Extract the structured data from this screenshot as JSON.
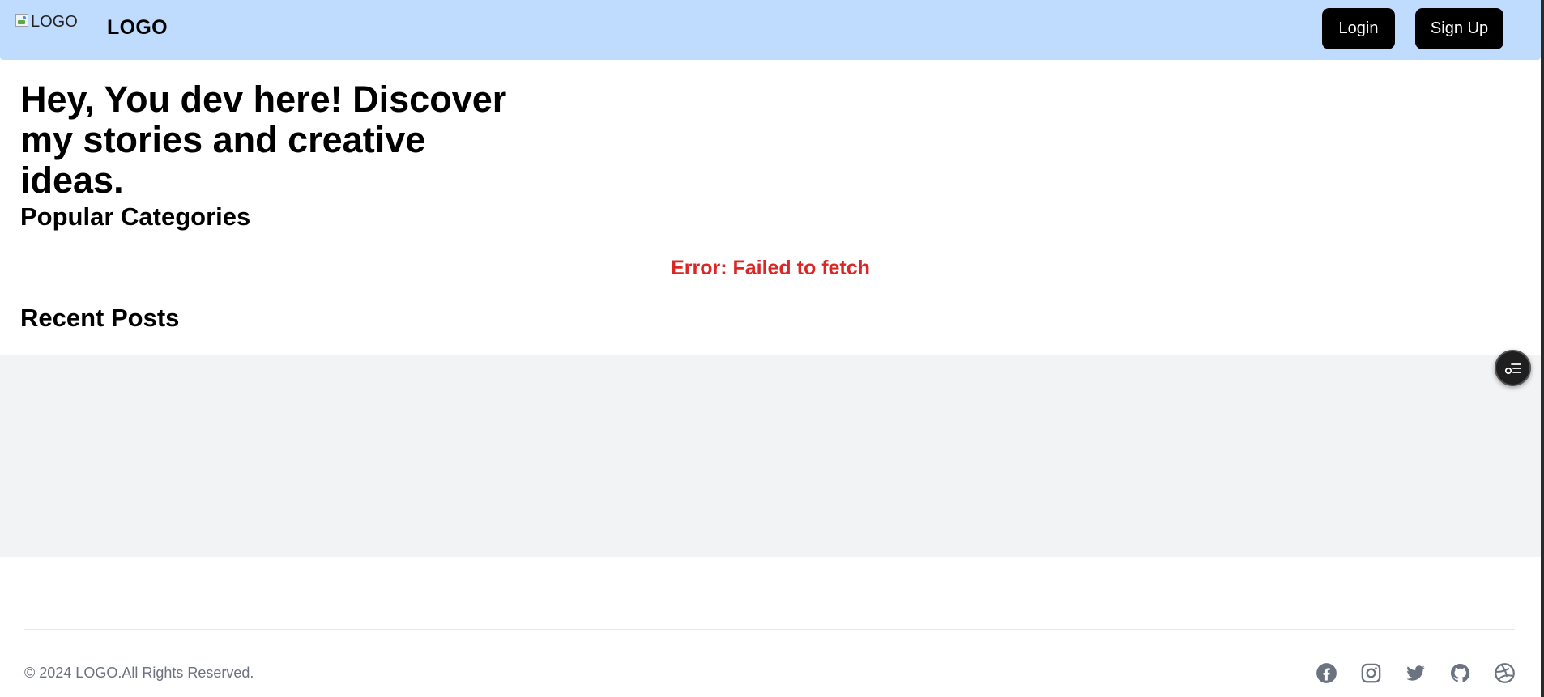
{
  "navbar": {
    "logo_alt": "LOGO",
    "logo_text": "LOGO",
    "login_label": "Login",
    "signup_label": "Sign Up",
    "background_color": "#bfdbfe"
  },
  "hero": {
    "bold_text": "Hey, You dev here!",
    "regular_text": "Discover my stories and creative ideas."
  },
  "sections": {
    "popular_title": "Popular Categories",
    "error_message": "Error: Failed to fetch",
    "error_color": "#dc2626",
    "recent_title": "Recent Posts"
  },
  "floating_button": {
    "icon": "menu-toggle-icon"
  },
  "footer": {
    "copyright": "© 2024 LOGO.All Rights Reserved.",
    "social_icons": [
      "facebook-icon",
      "instagram-icon",
      "twitter-icon",
      "github-icon",
      "dribbble-icon"
    ]
  }
}
